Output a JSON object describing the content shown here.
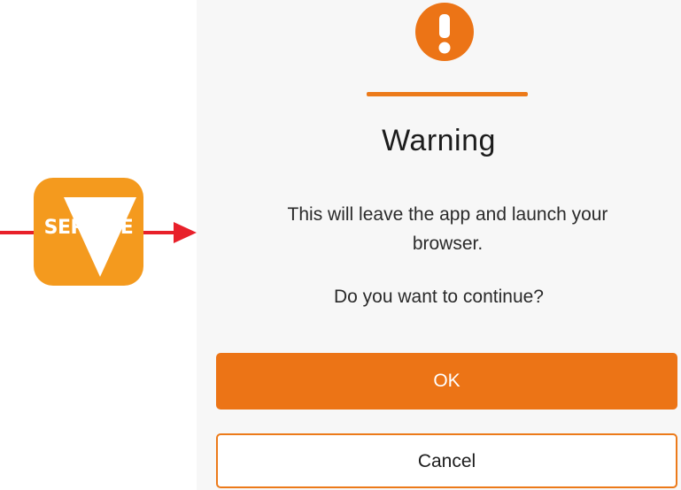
{
  "app_icon": {
    "text": "SERVICE",
    "background_color": "#f49a1e",
    "icon_name": "service-app-icon"
  },
  "annotation": {
    "color": "#e8202a",
    "icon_name": "red-arrow-icon"
  },
  "dialog": {
    "icon_name": "warning-exclamation-icon",
    "accent_color": "#ec7416",
    "title": "Warning",
    "message": "This will leave the app and launch your browser.",
    "question": "Do you want to continue?",
    "ok_label": "OK",
    "cancel_label": "Cancel"
  }
}
